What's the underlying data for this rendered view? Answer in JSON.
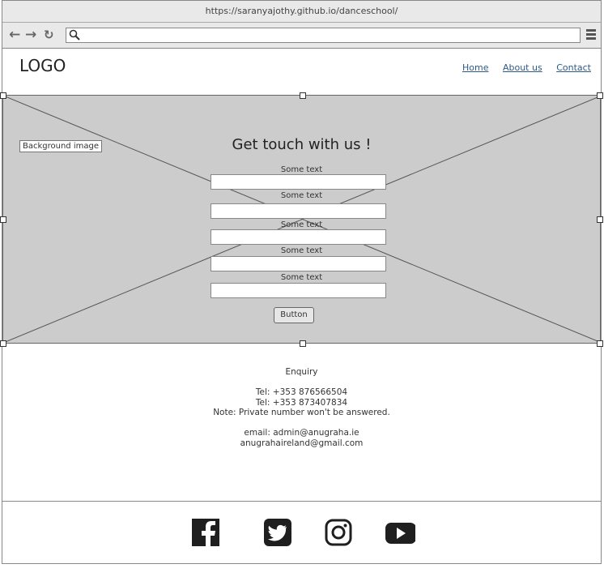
{
  "browser": {
    "url": "https://saranyajothy.github.io/danceschool/"
  },
  "header": {
    "logo": "LOGO",
    "nav": [
      "Home",
      "About us",
      "Contact"
    ]
  },
  "hero": {
    "background_label": "Background image",
    "title": "Get touch with us !",
    "fields": [
      {
        "label": "Some text",
        "value": ""
      },
      {
        "label": "Some text",
        "value": ""
      },
      {
        "label": "Some text",
        "value": ""
      },
      {
        "label": "Some text",
        "value": ""
      },
      {
        "label": "Some text",
        "value": ""
      }
    ],
    "button_label": "Button"
  },
  "contact": {
    "heading": "Enquiry",
    "tel1": "Tel: +353 876566504",
    "tel2": "Tel: +353 873407834",
    "note": "Note: Private number won't be answered.",
    "email1": "email: admin@anugraha.ie",
    "email2": "anugrahaireland@gmail.com"
  },
  "footer": {
    "icons": [
      "facebook-icon",
      "twitter-icon",
      "instagram-icon",
      "youtube-icon"
    ]
  }
}
